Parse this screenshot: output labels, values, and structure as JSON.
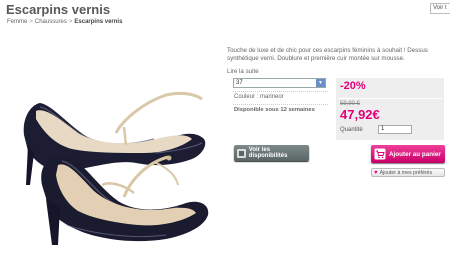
{
  "header": {
    "title": "Escarpins vernis",
    "voir_text": "Voir t"
  },
  "breadcrumb": [
    "Femme",
    "Chaussures",
    "Escarpins vernis"
  ],
  "product": {
    "description": "Touche de luxe et de chic pour ces escarpins féminins à souhait ! Dessus synthétique verni. Doublure et première cuir montée sur mousse.",
    "read_more": "Lire la suite",
    "size_selected": "37",
    "color_label": "Couleur : marineor",
    "availability": "Disponible sous 12 semaines",
    "availability_button": "Voir les disponibilités"
  },
  "pricing": {
    "discount": "-20%",
    "old_price": "59,90 €",
    "new_price": "47,92€",
    "quantity_label": "Quantité",
    "quantity_value": "1"
  },
  "actions": {
    "add_to_cart": "Ajouter au panier",
    "add_to_favorites": "Ajouter à mes préférés"
  },
  "colors": {
    "accent": "#e2007a",
    "shoe_patent": "#1a1b2e",
    "strap": "#d9c8a8"
  }
}
